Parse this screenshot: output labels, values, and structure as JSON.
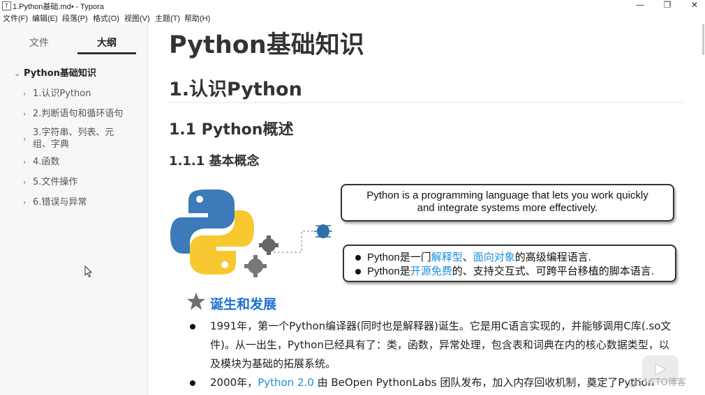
{
  "window": {
    "title": "1.Python基础.md• - Typora",
    "icon_letter": "T",
    "controls": {
      "minimize": "—",
      "maximize": "❐",
      "close": "✕"
    }
  },
  "menu": [
    "文件(F)",
    "编辑(E)",
    "段落(P)",
    "格式(O)",
    "视图(V)",
    "主题(T)",
    "帮助(H)"
  ],
  "sidebar": {
    "tabs": [
      {
        "label": "文件",
        "active": false
      },
      {
        "label": "大纲",
        "active": true
      }
    ],
    "outline": [
      {
        "label": "Python基础知识",
        "level": 1,
        "expanded": true
      },
      {
        "label": "1.认识Python",
        "level": 2
      },
      {
        "label": "2.判断语句和循环语句",
        "level": 2
      },
      {
        "label": "3.字符串、列表、元组、字典",
        "level": 2
      },
      {
        "label": "4.函数",
        "level": 2
      },
      {
        "label": "5.文件操作",
        "level": 2
      },
      {
        "label": "6.错误与异常",
        "level": 2
      }
    ]
  },
  "doc": {
    "h1": "Python基础知识",
    "h2": "1.认识Python",
    "h3": "1.1 Python概述",
    "h4": "1.1.1 基本概念",
    "figure": {
      "quote_line1": "Python is a programming language that lets you work quickly",
      "quote_line2": "and integrate systems more effectively.",
      "bullet1": {
        "prefix": "Python是一门",
        "hl1": "解释型",
        "sep": "、",
        "hl2": "面向对象",
        "suffix": "的高级编程语言."
      },
      "bullet2": {
        "prefix": "Python是",
        "hl1": "开源免费",
        "suffix": "的、支持交互式、可跨平台移植的脚本语言."
      }
    },
    "section_title": "诞生和发展",
    "para1": "1991年，第一个Python编译器(同时也是解释器)诞生。它是用C语言实现的，并能够调用C库(.so文件)。从一出生，Python已经具有了：类，函数，异常处理，包含表和词典在内的核心数据类型，以及模块为基础的拓展系统。",
    "para2": {
      "prefix": "2000年，",
      "hl": "Python 2.0",
      "suffix": " 由 BeOpen PythonLabs 团队发布，加入内存回收机制，奠定了Python"
    }
  },
  "watermark": "@51CTO博客",
  "colors": {
    "accent": "#1a8fe0",
    "section_title": "#1c6fd1",
    "python_blue": "#3d7ab8",
    "python_yellow": "#f7c82f"
  }
}
